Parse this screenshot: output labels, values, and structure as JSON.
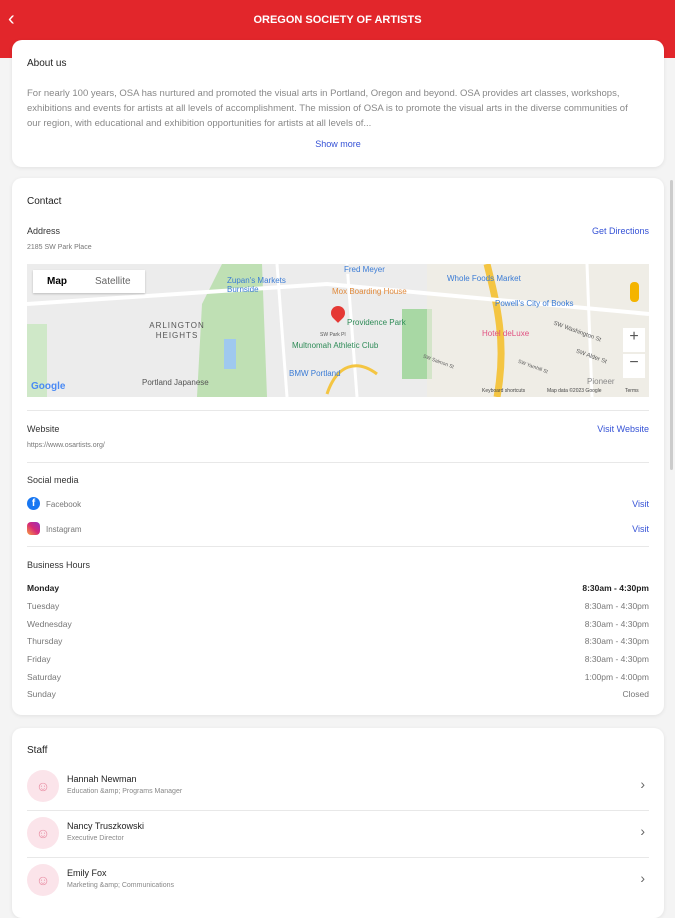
{
  "header": {
    "title": "OREGON SOCIETY OF ARTISTS",
    "back_icon": "chevron-left-icon"
  },
  "about": {
    "title": "About us",
    "text": "For nearly 100 years, OSA has nurtured and promoted the visual arts in Portland, Oregon and beyond. OSA provides art classes, workshops, exhibitions and events for artists at all levels of accomplishment. The mission of OSA is to promote the visual arts in the diverse communities of our region, with educational and exhibition opportunities for artists at all levels of...",
    "show_more": "Show more"
  },
  "contact": {
    "title": "Contact",
    "address_label": "Address",
    "address": "2185 SW Park Place",
    "directions": "Get Directions",
    "map": {
      "map_tab": "Map",
      "satellite_tab": "Satellite",
      "labels": [
        "Fred Meyer",
        "Zupan's Markets Burnside",
        "Mox Boarding House",
        "Whole Foods Market",
        "Powell's City of Books",
        "ARLINGTON HEIGHTS",
        "Providence Park",
        "SW Park Pl",
        "Multnomah Athletic Club",
        "Hotel deLuxe",
        "SW Washington St",
        "SW Alder St",
        "SW Yamhill St",
        "SW Salmon St",
        "BMW Portland",
        "Portland Japanese",
        "Pioneer",
        "Google",
        "Keyboard shortcuts",
        "Map data ©2023 Google",
        "Terms"
      ],
      "zoom_in": "+",
      "zoom_out": "−"
    },
    "website_label": "Website",
    "website": "https://www.osartists.org/",
    "visit_website": "Visit Website",
    "social_label": "Social media",
    "social": [
      {
        "name": "Facebook",
        "action": "Visit"
      },
      {
        "name": "Instagram",
        "action": "Visit"
      }
    ],
    "hours_label": "Business Hours",
    "hours": [
      {
        "day": "Monday",
        "time": "8:30am - 4:30pm"
      },
      {
        "day": "Tuesday",
        "time": "8:30am - 4:30pm"
      },
      {
        "day": "Wednesday",
        "time": "8:30am - 4:30pm"
      },
      {
        "day": "Thursday",
        "time": "8:30am - 4:30pm"
      },
      {
        "day": "Friday",
        "time": "8:30am - 4:30pm"
      },
      {
        "day": "Saturday",
        "time": "1:00pm - 4:00pm"
      },
      {
        "day": "Sunday",
        "time": "Closed"
      }
    ]
  },
  "staff": {
    "title": "Staff",
    "members": [
      {
        "name": "Hannah Newman",
        "role": "Education &amp; Programs Manager"
      },
      {
        "name": "Nancy Truszkowski",
        "role": "Executive Director"
      },
      {
        "name": "Emily Fox",
        "role": "Marketing &amp; Communications"
      }
    ]
  },
  "colors": {
    "brand": "#e2262b",
    "link": "#3552d6"
  }
}
